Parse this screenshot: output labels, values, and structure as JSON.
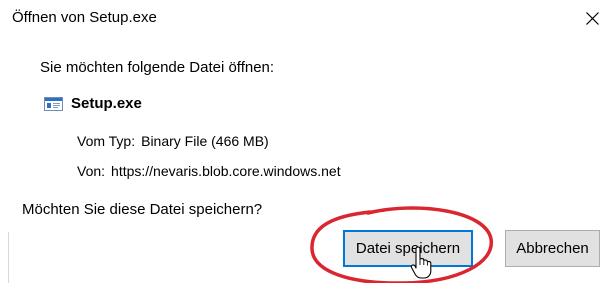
{
  "window": {
    "title": "Öffnen von Setup.exe",
    "close_icon": "close-icon"
  },
  "prompt": "Sie möchten folgende Datei öffnen:",
  "file": {
    "icon": "executable-file-icon",
    "name": "Setup.exe",
    "type_label": "Vom Typ:",
    "type_value": "Binary File (466 MB)",
    "from_label": "Von:",
    "from_value": "https://nevaris.blob.core.windows.net"
  },
  "question": "Möchten Sie diese Datei speichern?",
  "buttons": {
    "save_label": "Datei speichern",
    "cancel_label": "Abbrechen"
  },
  "annotation": {
    "ring_color": "#d9262f",
    "focus_color": "#0078d7"
  }
}
